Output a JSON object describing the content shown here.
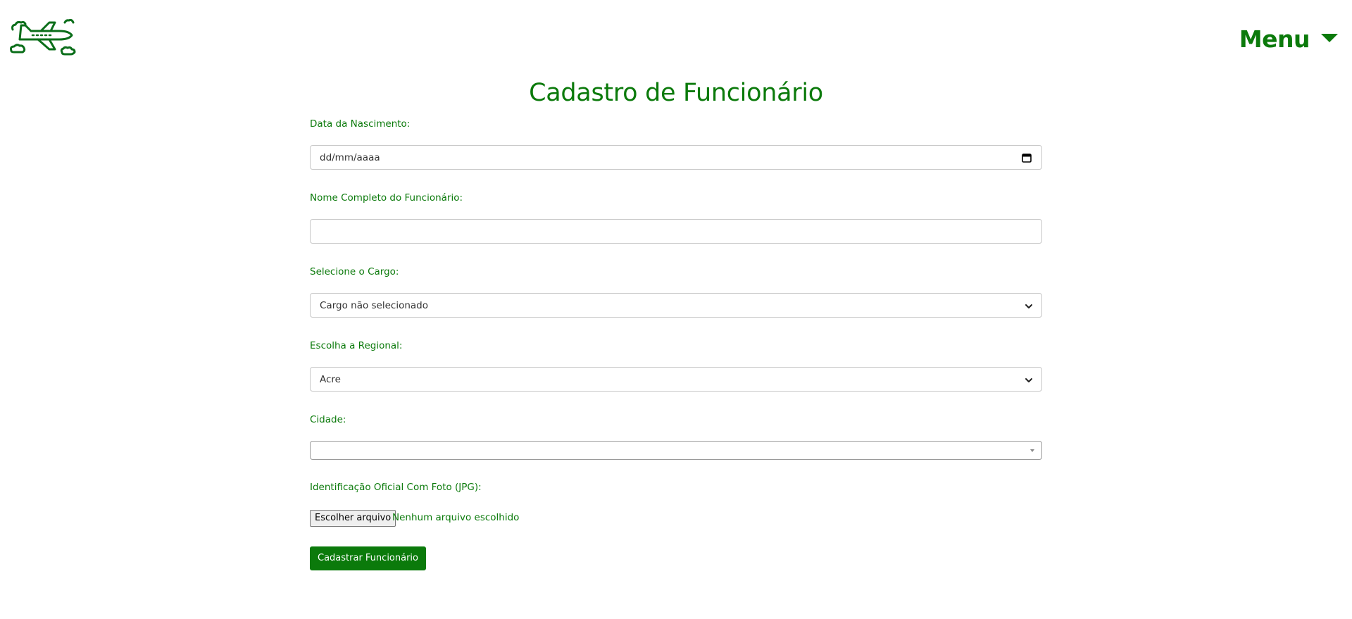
{
  "header": {
    "logo_icon": "airplane-icon",
    "menu_label": "Menu",
    "menu_icon": "caret-down-icon"
  },
  "page": {
    "title": "Cadastro de Funcionário"
  },
  "form": {
    "birth_date": {
      "label": "Data da Nascimento:",
      "placeholder": "dd/mm/aaaa",
      "icon": "calendar-icon"
    },
    "full_name": {
      "label": "Nome Completo do Funcionário:",
      "value": ""
    },
    "role": {
      "label": "Selecione o Cargo:",
      "selected": "Cargo não selecionado",
      "icon": "chevron-down-icon"
    },
    "regional": {
      "label": "Escolha a Regional:",
      "selected": "Acre",
      "icon": "chevron-down-icon"
    },
    "city": {
      "label": "Cidade:",
      "selected": ""
    },
    "photo_id": {
      "label": "Identificação Oficial Com Foto (JPG):",
      "button_label": "Escolher arquivo",
      "status": "Nenhum arquivo escolhido"
    },
    "submit_label": "Cadastrar Funcionário"
  },
  "colors": {
    "accent": "#0b7a0b",
    "field_border": "#c8c8c8",
    "text": "#333333"
  }
}
